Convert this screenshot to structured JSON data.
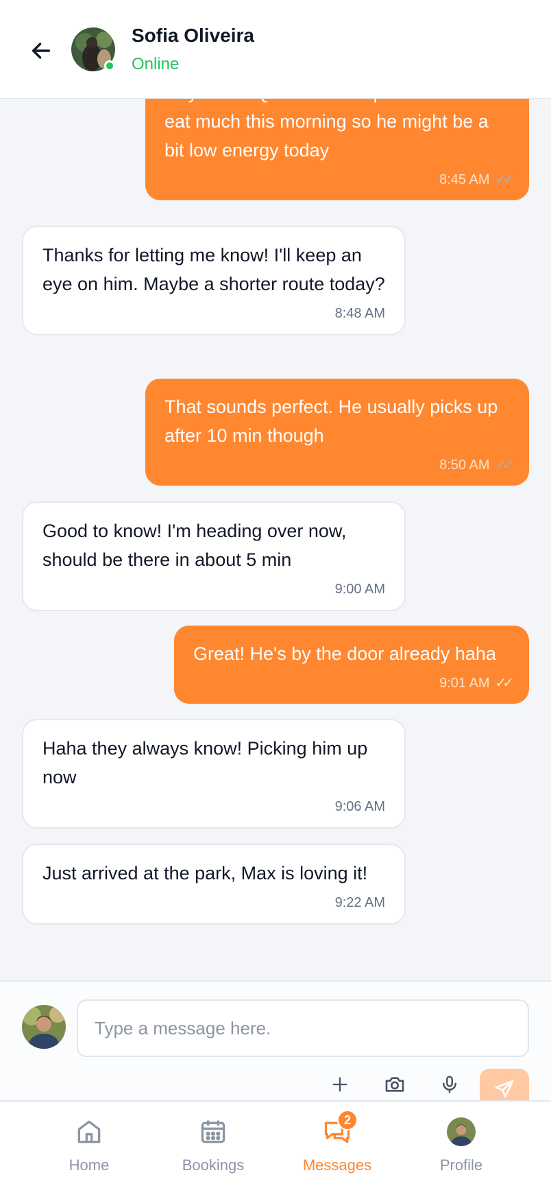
{
  "header": {
    "contact_name": "Sofia Oliveira",
    "status": "Online"
  },
  "messages": [
    {
      "direction": "out",
      "text": "Hey Sofia! Quick heads up — Max didn't eat much this morning so he might be a bit low energy today",
      "time": "8:45 AM",
      "read": true
    },
    {
      "direction": "in",
      "text": "Thanks for letting me know! I'll keep an eye on him. Maybe a shorter route today?",
      "time": "8:48 AM"
    },
    {
      "direction": "out",
      "text": "That sounds perfect. He usually picks up after 10 min though",
      "time": "8:50 AM",
      "read": true
    },
    {
      "direction": "in",
      "text": "Good to know! I'm heading over now, should be there in about 5 min",
      "time": "9:00 AM"
    },
    {
      "direction": "out",
      "text": "Great! He's by the door already haha",
      "time": "9:01 AM",
      "read": true
    },
    {
      "direction": "in",
      "text": "Haha they always know! Picking him up now",
      "time": "9:06 AM"
    },
    {
      "direction": "in",
      "text": "Just arrived at the park, Max is loving it!",
      "time": "9:22 AM"
    }
  ],
  "composer": {
    "placeholder": "Type a message here.",
    "value": "",
    "tools": [
      "plus-icon",
      "camera-icon",
      "microphone-icon",
      "send-icon"
    ]
  },
  "nav": {
    "items": [
      {
        "label": "Home",
        "icon": "home-icon",
        "active": false
      },
      {
        "label": "Bookings",
        "icon": "calendar-icon",
        "active": false
      },
      {
        "label": "Messages",
        "icon": "chat-icon",
        "active": true,
        "badge": "2"
      },
      {
        "label": "Profile",
        "icon": "avatar",
        "active": false
      }
    ]
  },
  "colors": {
    "accent": "#ff8730",
    "online": "#22c55e",
    "background": "#f3f5f9"
  }
}
